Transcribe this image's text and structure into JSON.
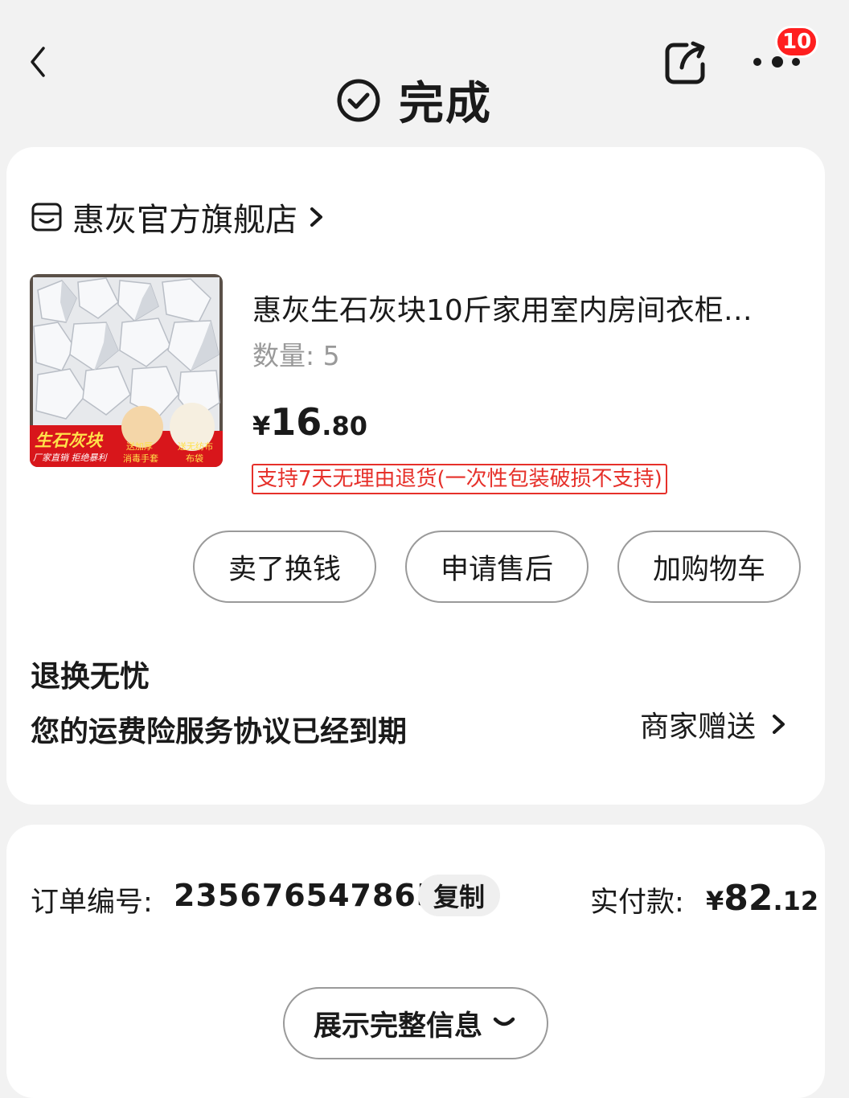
{
  "header": {
    "title": "完成",
    "more_badge": "10"
  },
  "store": {
    "name": "惠灰官方旗舰店"
  },
  "product": {
    "title": "惠灰生石灰块10斤家用室内房间衣柜…",
    "quantity_text": "数量: 5",
    "price_symbol": "¥",
    "price_int": "16",
    "price_dec": ".80",
    "return_policy": "支持7天无理由退货(一次性包装破损不支持)",
    "image_text": {
      "banner": "生石灰块",
      "sub": "厂家直销 拒绝暴利",
      "gift1_line1": "送加厚",
      "gift1_line2": "消毒手套",
      "gift2_line1": "送无纺布",
      "gift2_line2": "布袋"
    }
  },
  "actions": {
    "sell": "卖了换钱",
    "after_sale": "申请售后",
    "add_cart": "加购物车"
  },
  "return_service": {
    "title": "退换无忧",
    "desc": "您的运费险服务协议已经到期",
    "link": "商家赠送"
  },
  "order": {
    "label": "订单编号:",
    "number": "235676547865",
    "copy": "复制",
    "paid_label": "实付款:",
    "paid_symbol": "¥",
    "paid_int": "82",
    "paid_dec": ".12",
    "expand": "展示完整信息"
  }
}
